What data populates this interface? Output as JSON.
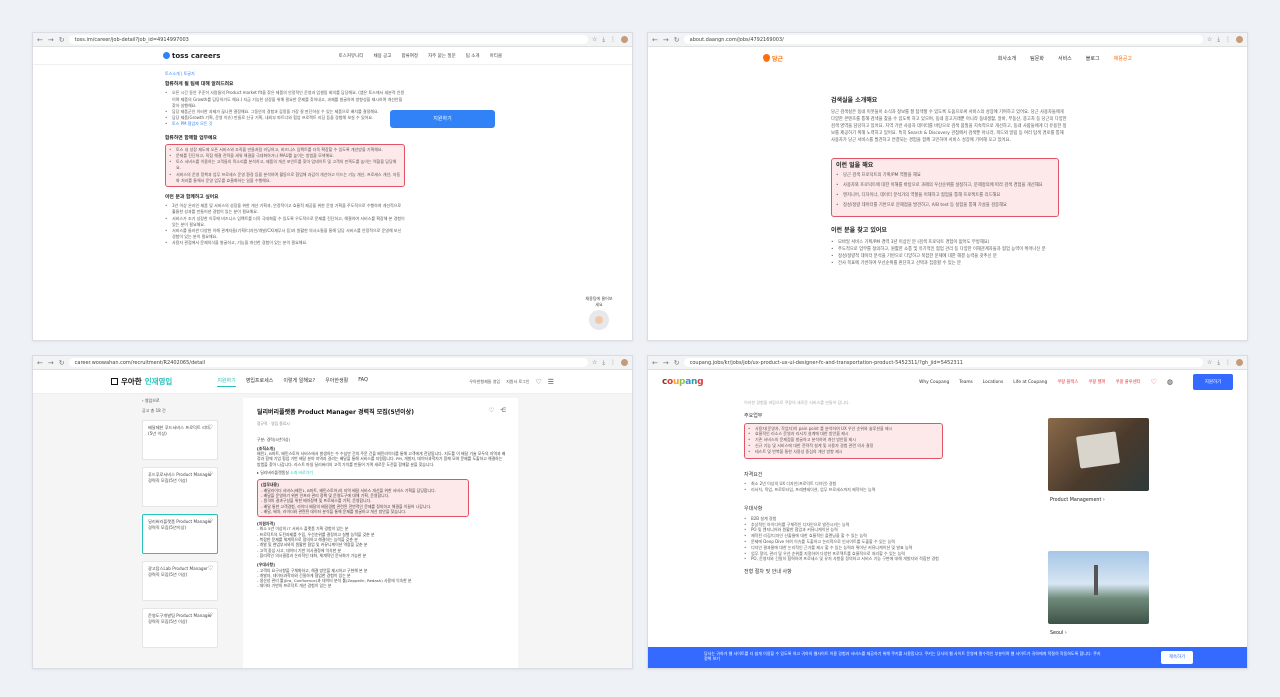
{
  "toss": {
    "url": "toss.im/career/job-detail?job_id=4914997003",
    "logo": "toss careers",
    "nav": [
      "토스커뮤니티",
      "채용 공고",
      "합류여정",
      "자주 묻는 질문",
      "팀 소개",
      "아티클"
    ],
    "breadcrumb": "토스소개 | 토글지",
    "section1_title": "합류하게 될 팀에 대해 알려드려요",
    "section1_items": [
      "오픈 시간 동안 꾸준히 사람들의 Product market fit을 찾은 제품의 안정적인 운영과 업셀링 회의를 담당해요. (앱은 토스에서 세분적 인원이며 제품의 Growth를 담당하기도 해요.) 지금 기능한 성장을 위해 필요한 문제를 찾아내고, 과제를 발굴하여 방향성을 제시하며 개선안을 찾아 실행해요.",
      "담당 제품군인 이러한 과제가 끊나면 결정해요. 그동안의 경험과 감정을 가장 잘 판단하실 수 있는 제품으로 배치를 결정해요.",
      "담당 제품(Growth 기획, 운영 이슈) 만들로 신규 기획, 내외부 파트너와 협업 프로젝트 리딩 등을 경험해 보실 수 있어요."
    ],
    "section1_link": "토스 PM 협업자 모든 것",
    "section2_title": "합류하면 함께할 업무예요",
    "section2_items": [
      "토스 내 성장 제도에 오픈 서비스와 조직을 만들처럼 리딩하고, 비즈니스 임팩트를 더욱 확장할 수 있도록 개선방을 기획해요.",
      "문제를 진단하고, 직접 해결 전략을 세워 해결을 극대화하거나 MAU를 높이는 방법을 모색해요.",
      "토스 서비스를 이용하는 고객들의 목소리를 분석하고, 제품의 개선 포인트를 찾아 업데이트 및 고객의 만족도를 높이는 역할을 담당해요.",
      "서비스의 운영 정책과 업무 프로세스 운영 환경 등을 분석하며 활동으로 협업해 과감히 개선하고 이드는 기능 개선, 프로세스 개선, 자동화 처리를 통해서 운영 업무를 효율화하는 일을 수행해요."
    ],
    "section3_title": "이런 분과 함께하고 싶어요",
    "section3_items": [
      "3년 이상 온라인 제품 및 서비스의 성장을 위한 개선 기획과, 안정적이고 효율적 제공을 위한 운영 기획을 주도적으로 수행하여 개선적으로 훌륭한 성과를 만들어낸 경험이 있는 분이 필요해요.",
      "서비스가 조기 성장한 이후에 비즈니스 임팩트를 더욱 극대화할 수 있도록 우도적으로 문제를 진단하고, 해결하여 서비스를 확장해 본 경험이 있는 분이 필요해요.",
      "서비스를 둘러싼 다양한 이해 관계자들(기획/디자인/개발/CX/재무사 등)과 원활한 의사소통을 통해 담당 서비스를 안정적으로 운영해 보신 경험이 있는 분이 필요해요.",
      "사용자 관점에서 문제의식을 발굴하고, 기능을 개선한 경험이 있는 분이 필요해요."
    ],
    "apply_label": "지원하기",
    "helper_label": "채용팀에 물어보세요"
  },
  "daangn": {
    "url": "about.daangn.com/jobs/4792169003/",
    "logo": "당근",
    "nav": [
      "회사소개",
      "팀문화",
      "서비스",
      "블로그",
      "채용공고"
    ],
    "intro_title": "검색실을 소개해요",
    "intro_text": "당근 검색실은 동네 이웃들이 소식과 정보를 잘 탐색할 수 있도록 도움으로써 서비스의 성장에 기여하고 있어요. 당근 사용자들에게 다양한 콘텐츠를 통해 검색을 찾을 수 있도록 하고 있으며, 동네 중고거래뿐 아니라 동네생활, 알바, 부동산, 중고차 등 당근의 다양한 검색 영역을 담당하고 있어요. 지역 기반 사용자 데이터를 바탕으로 검색 품질을 지속적으로 개선하고, 동네 사람들에게 더 유용한 정보를 제공하기 위해 노력하고 있어요. 특히 Search & Discovery 관점에서 검색뿐 아니라, 피드와 알림 등 여러 탐색 경로를 통해 사용자가 당근 서비스를 발견하고 연결되는 경험을 함께 고민하며 서비스 성장에 기여해 오고 있어요.",
    "box_title": "이런 일을 해요",
    "box_items": [
      "당근 검색 프로덕트의 기획/PM 역할을 해요",
      "사용자와 프로덕트에 대한 이해를 바탕으로 과제의 우선순위를 설정하고, 문제정의에 따라 검색 경험을 개선해요",
      "엔지니어, 디자이너, 데이터 분석가의 역할을 이해하고 협업을 통해 프로젝트를 리드해요",
      "정성/정량 데이터를 기반으로 문제점을 발견하고, A/B test 등 실험을 통해 가설을 검증해요"
    ],
    "find_title": "이런 분을 찾고 있어요",
    "find_items": [
      "모바일 서비스 기획/PM 경력 3년 이상인 분 (검색 프로덕트 경험이 없어도 무방해요)",
      "주도적으로 업무를 정의하고, 원활한 소통 및 유기적인 협업 관리 등 다양한 이해관계자들과 협업 능력이 뛰어나신 분",
      "정성/정량적 데이터 분석을 기반으로 다양하고 복잡한 문제에 대한 해결 능력을 갖추신 분",
      "전사 목표에 기반하여 우선순위를 판단하고 선택과 집중할 수 있는 분"
    ]
  },
  "woowahan": {
    "url": "career.woowahan.com/recruitment/R2402065/detail",
    "logo_main": "우아한",
    "logo_accent": "인재영입",
    "nav": [
      "지원하기",
      "영입프로세스",
      "이렇게 일해요?",
      "우아한생활",
      "FAQ"
    ],
    "right_links": [
      "우아한형제들 영입",
      "지원서 로그인"
    ],
    "back_label": "영입으로",
    "count_label": "공고 총 18 건",
    "cards": [
      "배달제한 푸드서비스 프로덕트 리더 (5년 이상)",
      "푸드푸로서비스 Product Manager 경력직 모집(5년 이상)",
      "딜리버리플랫폼 Product Manager 경력직 모집(5년이상)",
      "광고탑스Lab Product Manager 경력직 모집(5년 이상)",
      "운영도구개발팀 Product Manager 경력직 모집(5년 이상)"
    ],
    "title": "딜리버리플랫폼 Product Manager 경력직 모집(5년이상)",
    "tags": "정규직 · 영입 종료시",
    "division_label": "구분: 경력(5년이상)",
    "org_title": "[조직소개]",
    "org_text": "배민1, B마트, 배민스토어 서비스에서 발생하는 수 수십만 건의 주문 건을 배민라이더를 통해 고객에게 전달됩니다. 지도를 이 배달 기술 모두의 지역과 배정과 함께 기업 협업 기반 배달 분야 지역과 걸리는 배달을 통해 서비스를 지원합니다. PM, 개발자, 데이터과학자가 함께 모여 문제를 도출하고 해결하는 방법을 찾아 나갑니다. 라스트 마일 딜리버리의 고객 가치를 만들어 가며 새로운 도전을 함께할 분을 찾습니다.",
    "org_link_prefix": "딜리버리플랫폼실",
    "org_link": "소개 바로가기",
    "work_title": "[업무내용]",
    "work_items": [
      "배달라이더 서비스(배민1, B마트, 배민스토어)의 지역 배달 서비스 개선을 위한 서비스 기획을 담당합니다.",
      "배달을 운영하기 위한 인프라 관리 정책 및 운영도구에 대해 기획, 운영합니다.",
      "원격의 결과구성을 위한 배차정책 및 프로세스를 기획, 운영합니다.",
      "배달 통한 고객경험, 라이더 배달의 배달경험 관련된 전반적인 문제를 정의하고 해결을 이끌어 나갑니다.",
      "배달, 배차, 라이더와 관련된 데이터 분석을 통해 문제를 발굴하고 개선 방안을 찾습니다."
    ],
    "qual_title": "[지원자격]",
    "qual_items": [
      "최소 5년 이상의 IT 서비스 플랫폼 기획 경험이 있는 분",
      "프로덕트의 도전과제를 수립, 우선순위를 결정하고 실행 능력을 갖춘 분",
      "복잡한 문제를 체계적으로 정의하고 해결하는 능력을 갖춘 분",
      "개발 및 현업부서와의 원활한 협업 및 커뮤니케이션 역량을 갖춘 분",
      "고객 중심 사고, 데이터 기반 의사결정에 익숙한 분",
      "합리적인 의사결정과 논리적인 대화, 체계적인 문서화가 가능한 분"
    ],
    "pref_title": "[우대사항]",
    "pref_items": [
      "고객의 요구사항을 구체화하고, 해결 방안을 제시하고 구현해 본 분",
      "개발자, 데이터과학자와 긴밀하게 협업한 경험이 있는 분",
      "생산성 관리 툴(Jira, Confluence)과 데이터 분석 툴(Zeppelin, Redash) 사용에 익숙한 분",
      "데이터 기반의 프로덕트 개선 경험이 있는 분"
    ]
  },
  "coupang": {
    "url": "coupang.jobs/kr/jobs/job/ux-product-ux-ui-designer-fc-and-transportation-product-5452311/?gh_jid=5452311",
    "logo_letters": [
      "c",
      "o",
      "u",
      "p",
      "a",
      "n",
      "g"
    ],
    "logo_colors": [
      "#7b3f19",
      "#e4353b",
      "#f5a623",
      "#8bc34a",
      "#3a8ee6",
      "#24a0a8",
      "#e4353b"
    ],
    "nav": [
      "Why Coupang",
      "Teams",
      "Locations",
      "Life at Coupang",
      "쿠팡 플렉스",
      "쿠팡 헬퍼",
      "쿠팡 풀루센터"
    ],
    "apply_label": "지원하기",
    "top_text": "이러한 경험을 바탕으로 쿠팡의 새로운 서비스를 만들어 갑니다.",
    "duties_title": "주요업무",
    "duties_items": [
      "사용자(운영자, 작업자)의 pain point 를 분석하여 UX 우선 순위와 솔루션을 제시",
      "효율적인 리소스 운영과 리서치 설계에 대한 방안을 제시",
      "기존 서비스의 문제점을 발굴하고 분석하여 개선 방안을 제시",
      "신규 기능 및 서비스에 대한 전략적 설계 및 사용자 경험 관련 의사 결정",
      "테스트 및 반복을 통한 사용성 중심의 개선 방향 제시"
    ],
    "image1_caption": "Product Management",
    "image2_caption": "Seoul",
    "qual_title": "자격요건",
    "qual_items": [
      "최소 2년 이상의 UX 디자인(프로덕트 디자인) 경험",
      "리서치, 목업, 프로토타입, 프레젠테이션, 업무 프로세스까지 제작하는 능력"
    ],
    "pref_title": "우대사항",
    "pref_items": [
      "B2B 설계 경험",
      "추상적인 아이디어를 구체적인 디자인으로 발전시키는 능력",
      "PO 및 엔지니어와 원활한 협업과 커뮤니케이션 능력",
      "제작된 리깅/디자인 산출물에 대한 효율적인 플랜닝을 할 수 있는 능력",
      "문제에 Deep Dive 하여 이슈를 도출하고 논리적으로 인사이트를 도출할 수 있는 능력",
      "디자인 결과물에 대한 논리적인 근거를 제시 할 수 있는 능력과 뛰어난 커뮤니케이션 및 발표 능력",
      "업무 정의, 관리 및 우선 순위를 지정하여 다양한 프로젝트를 효율적으로 처리할 수 있는 능력",
      "PO, 운영자와 긴밀히 협력하여 프로세스 및 유저 사항을 정의하고 서비스 기능 구현에 대해 개발자와 적합한 경험"
    ],
    "process_title": "전형 절차 및 안내 사항",
    "cookie_text": "당사는 귀하가 웹 사이트를 더 쉽게 이용할 수 있도록 하고 귀하의 웹사이트 이용 경험과 서비스를 제공하기 위해 쿠키를 사용합니다. 쿠키는 당사의 웹 사이트 운영에 필수적인 부분이며 웹 사이트가 귀하에게 적절히 작동하도록 합니다. 쿠키 정책 보기",
    "cookie_button": "계속하기"
  }
}
